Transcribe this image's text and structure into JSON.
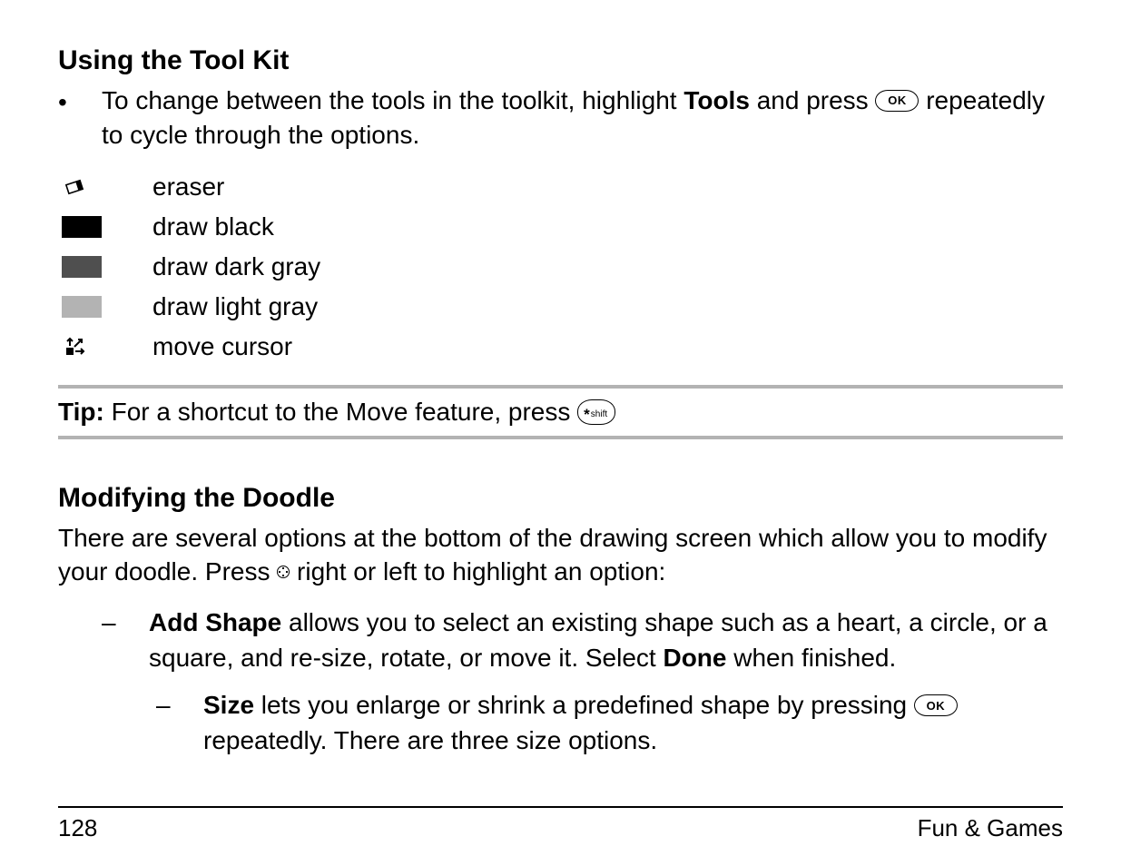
{
  "section1": {
    "heading": "Using the Tool Kit",
    "bullet_pre": "To change between the tools in the toolkit, highlight ",
    "bullet_bold": "Tools",
    "bullet_mid": " and press ",
    "ok_label": "OK",
    "bullet_post": " repeatedly to cycle through the options."
  },
  "tools": {
    "eraser": "eraser",
    "black": "draw black",
    "dgray": "draw dark gray",
    "lgray": "draw light gray",
    "move": "move cursor"
  },
  "tip": {
    "label": "Tip:",
    "text": " For a shortcut to the Move feature, press ",
    "shift_star": "*",
    "shift_text": "shift"
  },
  "section2": {
    "heading": "Modifying the Doodle",
    "para_pre": "There are several options at the bottom of the drawing screen which allow you to modify your doodle. Press ",
    "para_post": " right or left to highlight an option:"
  },
  "addshape": {
    "label": "Add Shape",
    "text_mid": " allows you to select an existing shape such as a heart, a circle, or a square, and re-size, rotate, or move it. Select ",
    "done": "Done",
    "text_post": " when finished."
  },
  "size": {
    "label": "Size",
    "text_pre": " lets you enlarge or shrink a predefined shape by pressing ",
    "text_post": " repeatedly. There are three size options."
  },
  "footer": {
    "page": "128",
    "section": "Fun & Games"
  },
  "dash": "–",
  "bullet_glyph": "•"
}
